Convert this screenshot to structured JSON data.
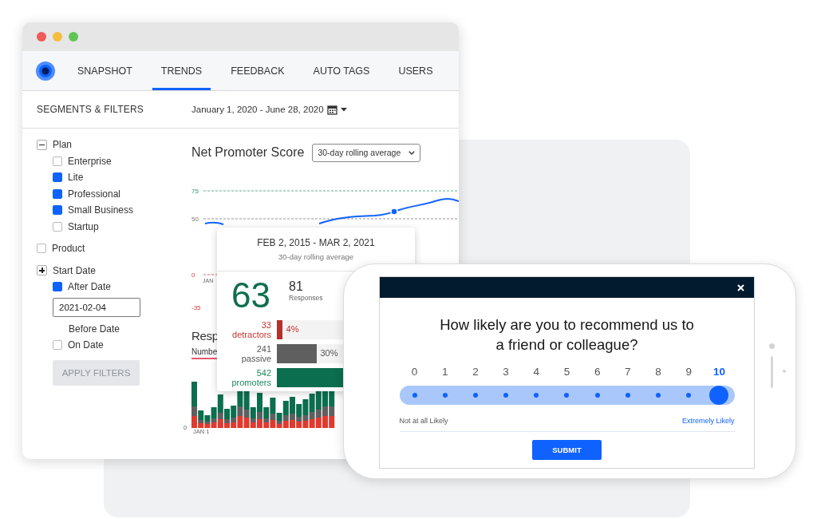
{
  "window": {
    "tabs": [
      {
        "label": "SNAPSHOT",
        "selected": false
      },
      {
        "label": "TRENDS",
        "selected": true
      },
      {
        "label": "FEEDBACK",
        "selected": false
      },
      {
        "label": "AUTO TAGS",
        "selected": false
      },
      {
        "label": "USERS",
        "selected": false
      }
    ]
  },
  "filters": {
    "title": "SEGMENTS & FILTERS",
    "groups": [
      {
        "label": "Plan",
        "kind": "collapsible",
        "expanded": true,
        "items": [
          {
            "label": "Enterprise",
            "kind": "checkbox",
            "checked": false
          },
          {
            "label": "Lite",
            "kind": "checkbox",
            "checked": true
          },
          {
            "label": "Professional",
            "kind": "checkbox",
            "checked": true
          },
          {
            "label": "Small Business",
            "kind": "checkbox",
            "checked": true
          },
          {
            "label": "Startup",
            "kind": "checkbox",
            "checked": false
          }
        ]
      },
      {
        "label": "Product",
        "kind": "checkbox",
        "checked": false
      },
      {
        "label": "Start Date",
        "kind": "collapsible",
        "expanded": false,
        "items": [
          {
            "label": "After Date",
            "kind": "checkbox",
            "checked": true
          },
          {
            "kind": "field",
            "value": "2021-02-04"
          },
          {
            "label": "Before Date",
            "kind": "label"
          },
          {
            "label": "On Date",
            "kind": "checkbox",
            "checked": false
          }
        ]
      }
    ],
    "apply_button": {
      "label": "APPLY FILTERS",
      "disabled": true
    }
  },
  "date_range": "January 1, 2020 - June 28, 2020",
  "nps": {
    "title": "Net Promoter Score",
    "dropdown": "30-day rolling average",
    "axis_labels": [
      {
        "label": "75",
        "kind": "high"
      },
      {
        "label": "50",
        "kind": "mid"
      },
      {
        "label": "0",
        "kind": "zero"
      },
      {
        "label": "-35",
        "kind": "low"
      }
    ],
    "x_label": "JAN"
  },
  "responses": {
    "title": "Resp",
    "tab": "Numbe",
    "zero_label": "0",
    "start_label": "JAN 1"
  },
  "tooltip": {
    "date_range": "FEB 2, 2015 - MAR 2, 2021",
    "subtitle": "30-day rolling average",
    "score": "63",
    "responses": "81",
    "responses_label": "Responses",
    "rows": [
      {
        "count": "33",
        "label": "detractors",
        "kind": "detractor",
        "level": 0.04,
        "percent": "4%"
      },
      {
        "count": "241",
        "label": "passive",
        "kind": "passive",
        "level": 0.3,
        "percent": "30%"
      },
      {
        "count": "542",
        "label": "promoters",
        "kind": "promoter",
        "level": 0.66
      }
    ]
  },
  "survey": {
    "question": "How likely are you to recommend us to a friend or colleague?",
    "scale": [
      {
        "label": "0",
        "selected": false
      },
      {
        "label": "1",
        "selected": false
      },
      {
        "label": "2",
        "selected": false
      },
      {
        "label": "3",
        "selected": false
      },
      {
        "label": "4",
        "selected": false
      },
      {
        "label": "5",
        "selected": false
      },
      {
        "label": "6",
        "selected": false
      },
      {
        "label": "7",
        "selected": false
      },
      {
        "label": "8",
        "selected": false
      },
      {
        "label": "9",
        "selected": false
      },
      {
        "label": "10",
        "selected": true
      }
    ],
    "low_label": "Not at all Likely",
    "high_label": "Extremely Likely",
    "submit": "SUBMIT"
  }
}
